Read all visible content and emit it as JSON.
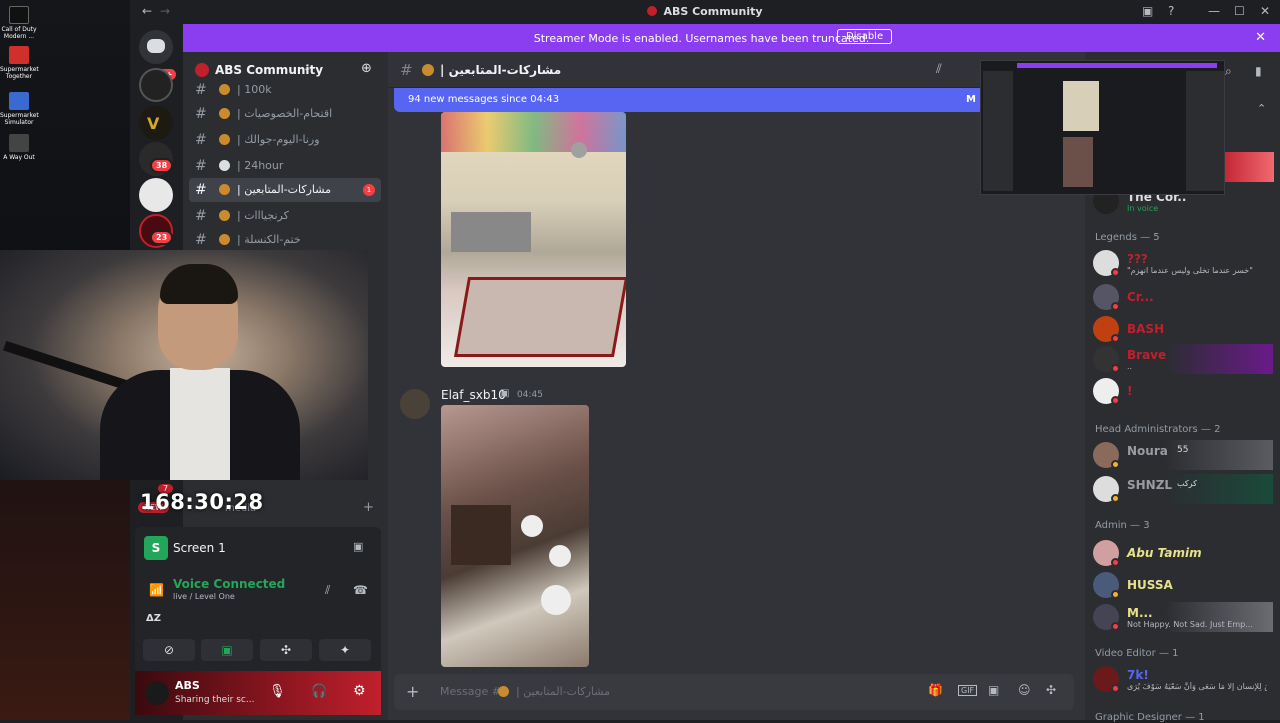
{
  "desktop": {
    "icons": [
      {
        "label": "Call of Duty Modern ...",
        "icon": "cod-icon",
        "color": "#111111"
      },
      {
        "label": "Supermarket Together",
        "icon": "supermarket-together-icon",
        "color": "#d0302a"
      },
      {
        "label": "Supermarket Simulator",
        "icon": "supermarket-simulator-icon",
        "color": "#3a6ad0"
      },
      {
        "label": "A Way Out",
        "icon": "a-way-out-icon",
        "color": "#444444"
      }
    ]
  },
  "window": {
    "title": "ABS Community",
    "back": "←",
    "forward": "→"
  },
  "banner": {
    "text": "Streamer Mode is enabled. Usernames have been truncated.",
    "button": "Disable",
    "close": "✕"
  },
  "rail": {
    "badges": {
      "home": "1K+",
      "s4": "38",
      "s6": "23"
    }
  },
  "sidebar": {
    "guild_name": "ABS Community",
    "channels": [
      {
        "name": "| 100k",
        "active": false
      },
      {
        "name": "| اقتحام-الخصوصيات",
        "active": false
      },
      {
        "name": "| ورنا-اليوم-جوالك",
        "active": false
      },
      {
        "name": "| 24hour",
        "active": false
      },
      {
        "name": "| مشاركات-المتابعين",
        "active": true,
        "unread": "1"
      },
      {
        "name": "| كرنجيااات",
        "active": false
      },
      {
        "name": "| ختم-الكنسلة",
        "active": false
      }
    ],
    "category_media": "media"
  },
  "timer": "168:30:28",
  "overlay_badge": {
    "count": "7",
    "new": "NEW"
  },
  "voice": {
    "screen_label": "Screen 1",
    "screen_initial": "S",
    "connected": "Voice Connected",
    "channel": "live",
    "level": "/ Level One",
    "user_tag": "ΔZ"
  },
  "userbar": {
    "name": "ABS",
    "status": "Sharing their sc..."
  },
  "chat": {
    "channel": "| مشاركات-المتابعين",
    "new_messages": "94 new messages since 04:43",
    "mark": "M",
    "message": {
      "author": "Elaf_sxb10",
      "time": "04:45"
    },
    "composer_placeholder": "Message #",
    "composer_channel": "| مشاركات-المتابعين"
  },
  "members": {
    "voice_user": {
      "name": "The Cor..",
      "status": "In voice"
    },
    "groups": [
      {
        "title": "Legends — 5",
        "members": [
          {
            "name": "???",
            "status": "\"خسر عندما تخلى وليس عندما انهزم\"",
            "color": "#c0202c"
          },
          {
            "name": "Cr...",
            "status": "",
            "color": "#c0202c"
          },
          {
            "name": "BASH",
            "status": "",
            "color": "#c0202c"
          },
          {
            "name": "Brave",
            "status": "..",
            "color": "#c0202c"
          },
          {
            "name": "!",
            "status": "",
            "color": "#c0202c"
          }
        ]
      },
      {
        "title": "Head Administrators — 2",
        "members": [
          {
            "name": "Noura",
            "status": "",
            "tag": "55",
            "color": "#9a9ca2"
          },
          {
            "name": "SHNZL",
            "status": "",
            "tag": "كركب",
            "color": "#9a9ca2"
          }
        ]
      },
      {
        "title": "Admin — 3",
        "members": [
          {
            "name": "Abu Tamim",
            "status": "",
            "color": "#e8e08a"
          },
          {
            "name": "HUSSA",
            "status": "",
            "color": "#e8e08a"
          },
          {
            "name": "M...",
            "status": "Not Happy. Not Sad. Just Emp...",
            "color": "#e8e08a"
          }
        ]
      },
      {
        "title": "Video Editor — 1",
        "members": [
          {
            "name": "7k!",
            "status": "لَيْسَ لِلإنسانِ إِلَّا مَا سَعَى وَأَنَّ سَعْيَهُ سَوْفَ يُرَى",
            "color": "#5865f2"
          }
        ]
      },
      {
        "title": "Graphic Designer — 1",
        "members": []
      }
    ]
  },
  "colors": {
    "accent": "#5865f2",
    "streamer": "#8b3df0",
    "dnd": "#f23f43",
    "online": "#23a55a"
  }
}
